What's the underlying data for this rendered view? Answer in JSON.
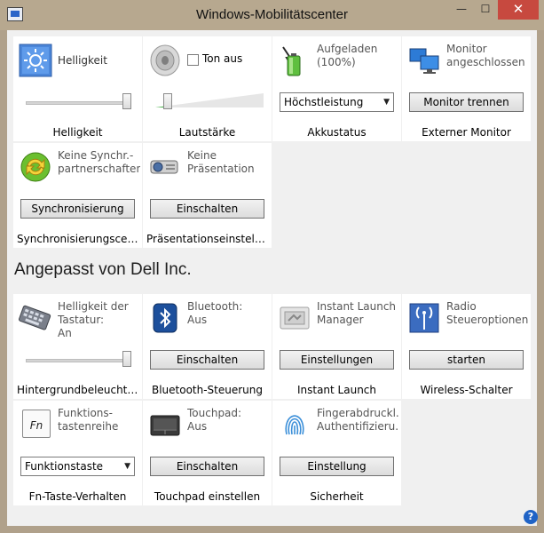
{
  "window": {
    "title": "Windows-Mobilitätscenter",
    "close_glyph": "✕",
    "minimize_glyph": "—",
    "maximize_glyph": "☐"
  },
  "tiles": {
    "brightness": {
      "label": "Helligkeit",
      "footer": "Helligkeit",
      "icon": "brightness-icon",
      "level": 0.95
    },
    "volume": {
      "mute_label": "Ton aus",
      "muted": false,
      "footer": "Lautstärke",
      "icon": "speaker-icon",
      "level": 0.08
    },
    "battery": {
      "label": "Aufgeladen\n(100%)",
      "select_value": "Höchstleistung",
      "footer": "Akkustatus",
      "icon": "battery-icon"
    },
    "display": {
      "label": "Monitor\nangeschlossen",
      "button": "Monitor trennen",
      "footer": "Externer Monitor",
      "icon": "monitor-icon"
    },
    "sync": {
      "label": "Keine Synchr.-\npartnerschaften",
      "button": "Synchronisierung",
      "footer": "Synchronisierungscenter",
      "icon": "sync-icon"
    },
    "presentation": {
      "label": "Keine\nPräsentation",
      "button": "Einschalten",
      "footer": "Präsentationseinstellun...",
      "icon": "projector-icon"
    }
  },
  "section": {
    "title": "Angepasst von Dell Inc."
  },
  "dell": {
    "keyboard_backlight": {
      "label": "Helligkeit der\nTastatur:\nAn",
      "footer": "Hintergrundbeleuchtun...",
      "icon": "keyboard-icon",
      "level": 0.95
    },
    "bluetooth": {
      "label": "Bluetooth:\nAus",
      "button": "Einschalten",
      "footer": "Bluetooth-Steuerung",
      "icon": "bluetooth-icon"
    },
    "instant_launch": {
      "label": "Instant Launch\nManager",
      "button": "Einstellungen",
      "footer": "Instant Launch",
      "icon": "instant-launch-icon"
    },
    "radio": {
      "label": "Radio\nSteueroptionen",
      "button": "starten",
      "footer": "Wireless-Schalter",
      "icon": "antenna-icon"
    },
    "fn_keys": {
      "label": "Funktions-\ntastenreihe",
      "select_value": "Funktionstaste",
      "footer": "Fn-Taste-Verhalten",
      "icon": "fn-key-icon",
      "icon_text": "Fn"
    },
    "touchpad": {
      "label": "Touchpad:\nAus",
      "button": "Einschalten",
      "footer": "Touchpad einstellen",
      "icon": "touchpad-icon"
    },
    "fingerprint": {
      "label": "Fingerabdruckl...\nAuthentifizieru...",
      "button": "Einstellung",
      "footer": "Sicherheit",
      "icon": "fingerprint-icon"
    }
  },
  "help": {
    "glyph": "?"
  },
  "colors": {
    "titlebar": "#b7a88f",
    "close": "#c7493f",
    "help": "#1f63c6"
  }
}
